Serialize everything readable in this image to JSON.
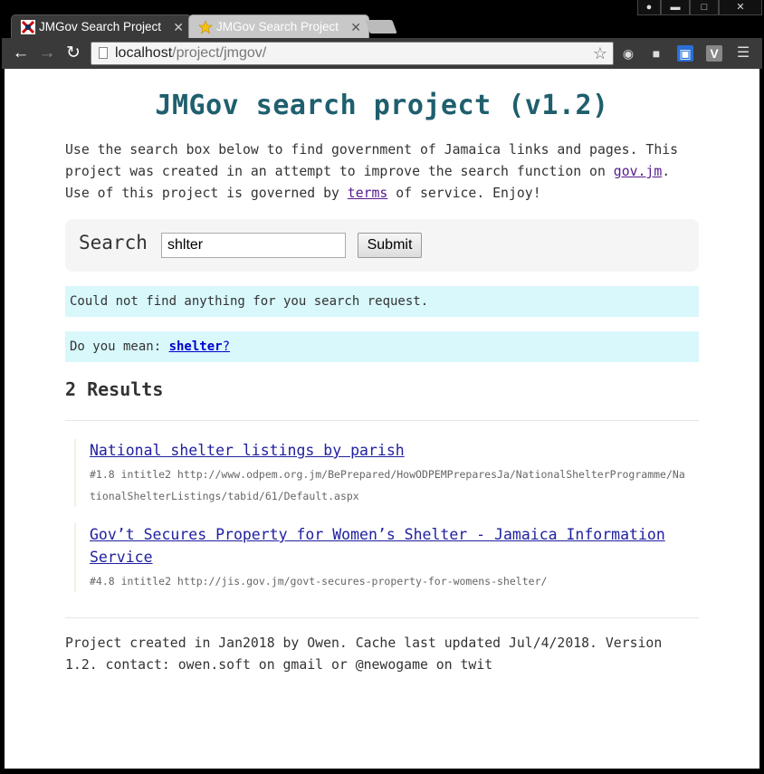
{
  "browser": {
    "tabs": [
      {
        "title": "JMGov Search Project",
        "active": true
      },
      {
        "title": "JMGov Search Project",
        "active": false
      }
    ],
    "url_host": "localhost",
    "url_path": "/project/jmgov/",
    "window_buttons": [
      "person-icon",
      "minimize-icon",
      "maximize-icon",
      "close-icon"
    ]
  },
  "page": {
    "title": "JMGov search project (v1.2)",
    "intro_before_link": "Use the search box below to find government of Jamaica links and pages. This project was created in an attempt to improve the search function on ",
    "intro_link": "gov.jm",
    "intro_middle": ". Use of this project is governed by ",
    "terms_link": "terms",
    "intro_after": " of service. Enjoy!",
    "search_label": "Search",
    "search_value": "shlter",
    "submit_label": "Submit",
    "no_results": "Could not find anything for you search request.",
    "suggest_prefix": "Do you mean: ",
    "suggest_word": "shelter",
    "suggest_q": "?",
    "results_count": "2 Results",
    "results": [
      {
        "title": "National shelter listings by parish",
        "meta": "#1.8 intitle2 http://www.odpem.org.jm/BePrepared/HowODPEMPreparesJa/NationalShelterProgramme/NationalShelterListings/tabid/61/Default.aspx"
      },
      {
        "title": "Gov’t Secures Property for Women’s Shelter - Jamaica Information Service",
        "meta": "#4.8 intitle2 http://jis.gov.jm/govt-secures-property-for-womens-shelter/"
      }
    ],
    "footer": "Project created in Jan2018 by Owen. Cache last updated Jul/4/2018. Version 1.2. contact: owen.soft on gmail or @newogame on twit"
  },
  "colors": {
    "title": "#1f5f6e",
    "notice_bg": "#d8f8fb",
    "search_bg": "#f5f5f5"
  }
}
